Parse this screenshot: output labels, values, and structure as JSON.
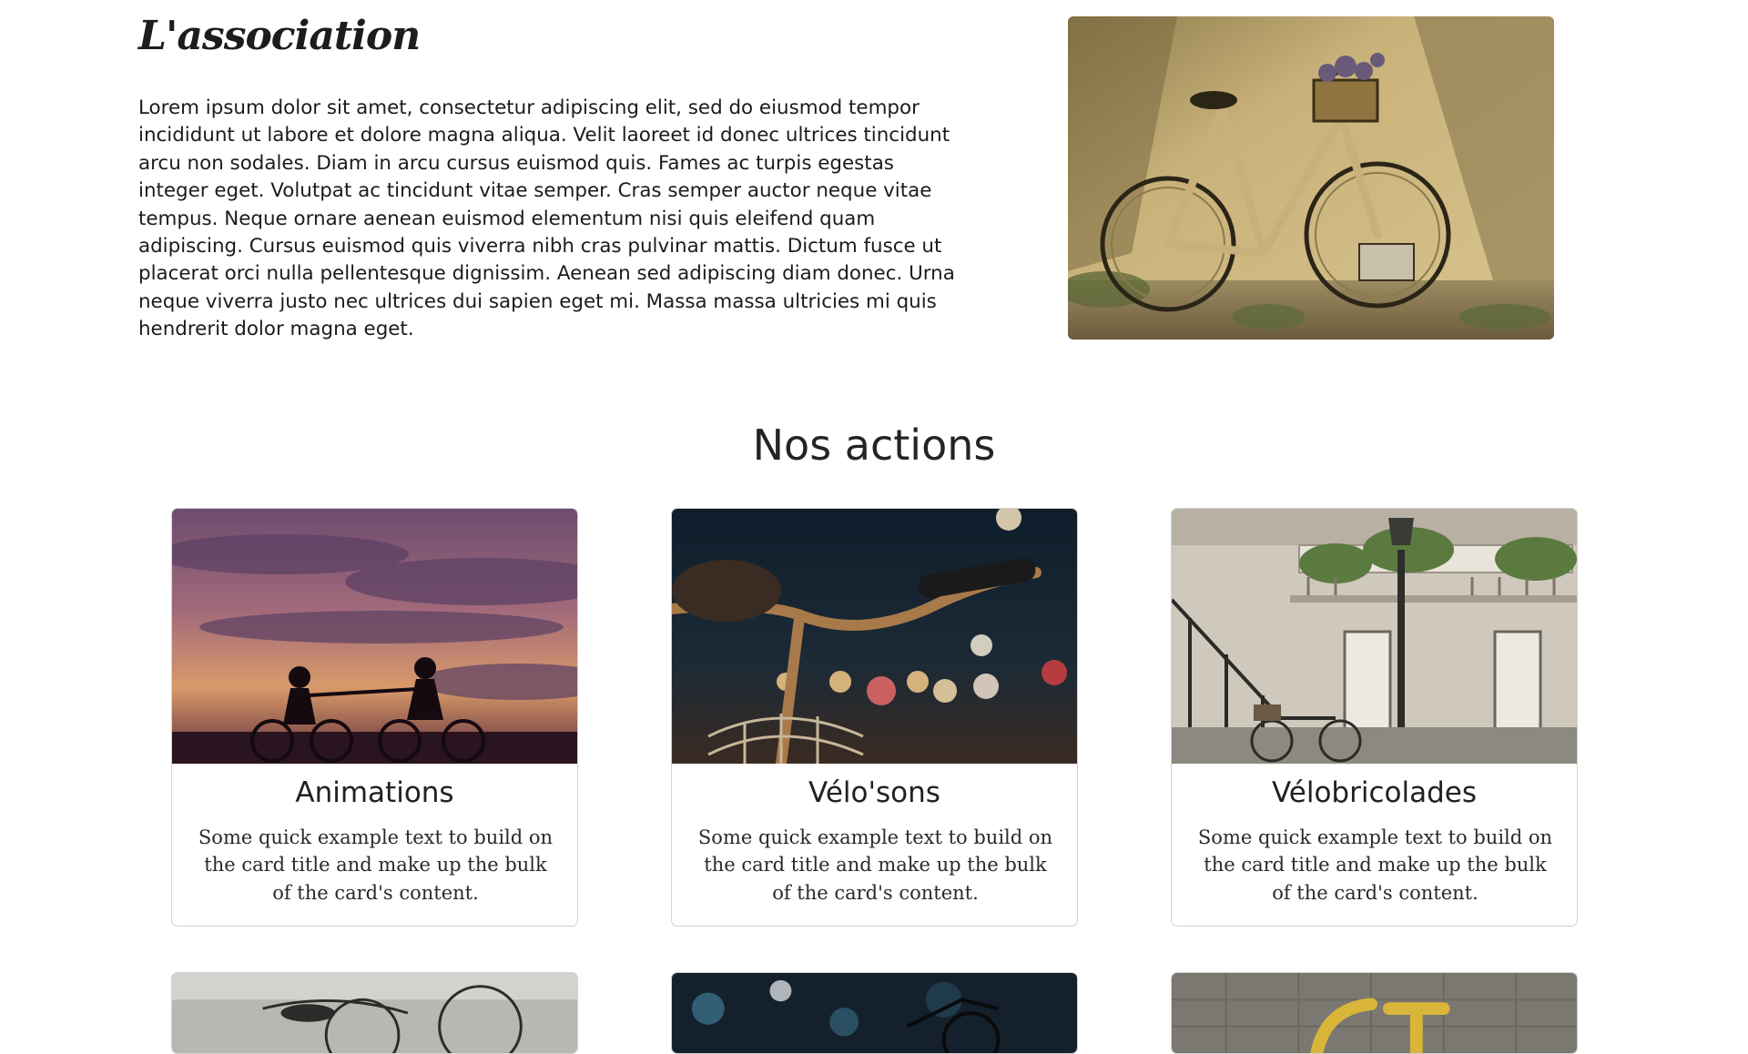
{
  "about": {
    "title": "L'association",
    "text": "Lorem ipsum dolor sit amet, consectetur adipiscing elit, sed do eiusmod tempor incididunt ut labore et dolore magna aliqua. Velit laoreet id donec ultrices tincidunt arcu non sodales. Diam in arcu cursus euismod quis. Fames ac turpis egestas integer eget. Volutpat ac tincidunt vitae semper. Cras semper auctor neque vitae tempus. Neque ornare aenean euismod elementum nisi quis eleifend quam adipiscing. Cursus euismod quis viverra nibh cras pulvinar mattis. Dictum fusce ut placerat orci nulla pellentesque dignissim. Aenean sed adipiscing diam donec. Urna neque viverra justo nec ultrices dui sapien eget mi. Massa massa ultricies mi quis hendrerit dolor magna eget."
  },
  "actions": {
    "title": "Nos actions",
    "cards": [
      {
        "title": "Animations",
        "text": "Some quick example text to build on the card title and make up the bulk of the card's content."
      },
      {
        "title": "Vélo'sons",
        "text": "Some quick example text to build on the card title and make up the bulk of the card's content."
      },
      {
        "title": "Vélobricolades",
        "text": "Some quick example text to build on the card title and make up the bulk of the card's content."
      }
    ]
  }
}
